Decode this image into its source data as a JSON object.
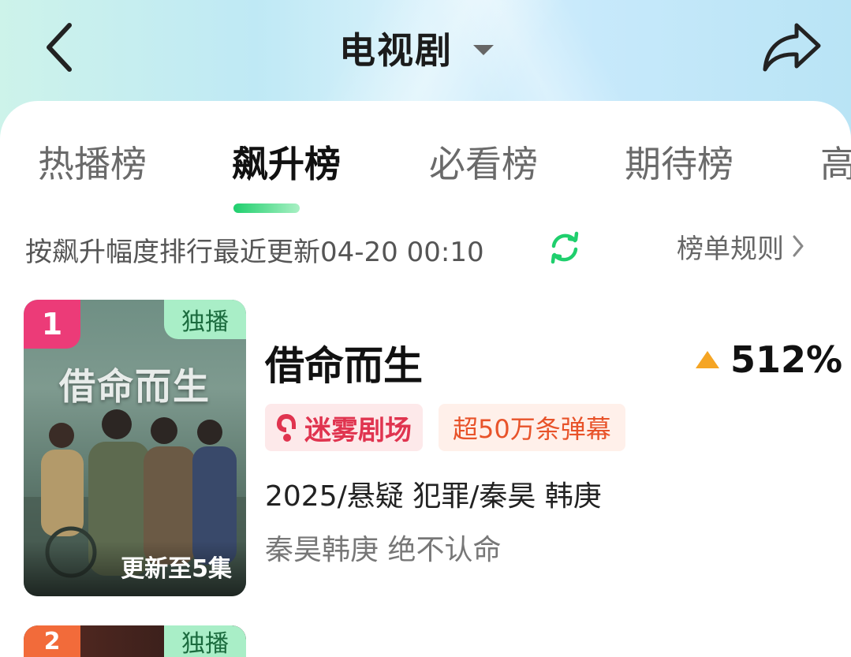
{
  "header": {
    "title": "电视剧",
    "back_icon": "chevron-left-icon",
    "share_icon": "share-arrow-icon",
    "dropdown_icon": "caret-down-icon"
  },
  "tabs": [
    {
      "label": "热播榜",
      "active": false
    },
    {
      "label": "飙升榜",
      "active": true
    },
    {
      "label": "必看榜",
      "active": false
    },
    {
      "label": "期待榜",
      "active": false
    },
    {
      "label": "高",
      "active": false
    }
  ],
  "info": {
    "sort_text": "按飙升幅度排行最近更新04-20 00:10",
    "refresh_icon": "refresh-icon",
    "rules_label": "榜单规则",
    "rules_icon": "chevron-right-icon"
  },
  "items": [
    {
      "rank": "1",
      "exclusive": "独播",
      "poster_title": "借命而生",
      "episode": "更新至5集",
      "title": "借命而生",
      "trend": "512%",
      "trend_icon": "up-triangle-icon",
      "tag_theater": "迷雾剧场",
      "tag_danmaku": "超50万条弹幕",
      "meta": "2025/悬疑 犯罪/秦昊 韩庚",
      "desc": "秦昊韩庚 绝不认命"
    },
    {
      "rank": "2",
      "exclusive": "独播"
    }
  ],
  "colors": {
    "accent_green": "#1fcf6d",
    "rank1": "#ec3b78",
    "rank2": "#f26b3a",
    "trend_up": "#f5a524",
    "theater_red": "#e0344f",
    "danmaku_orange": "#e8532a"
  }
}
